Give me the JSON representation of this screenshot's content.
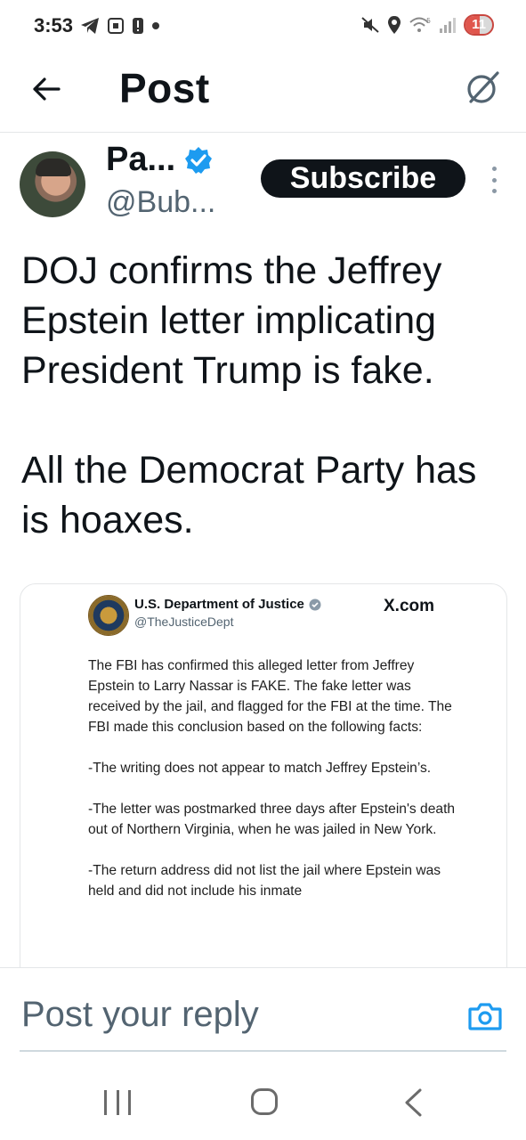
{
  "status_bar": {
    "time": "3:53",
    "battery": "11",
    "icons": [
      "telegram-icon",
      "screenshot-icon",
      "alert-icon",
      "dot-icon",
      "mute-icon",
      "location-icon",
      "wifi-icon",
      "signal-icon"
    ]
  },
  "header": {
    "title": "Post",
    "back_icon": "arrow-left-icon",
    "grok_icon": "grok-icon"
  },
  "author": {
    "display_name": "Pa...",
    "handle": "@Bub...",
    "subscribe_label": "Subscribe"
  },
  "post": {
    "paragraphs": [
      "DOJ confirms the Jeffrey Epstein letter implicating President Trump is fake.",
      "All the Democrat Party has is hoaxes."
    ]
  },
  "embed": {
    "name": "U.S. Department of Justice",
    "handle": "@TheJusticeDept",
    "source": "X.com",
    "paragraphs": [
      "The FBI has confirmed this alleged letter from Jeffrey Epstein to Larry Nassar is FAKE. The fake letter was received by the jail, and flagged for the FBI at the time. The FBI made this conclusion based on the following facts:",
      "-The writing does not appear to match Jeffrey Epstein’s.",
      "-The letter was postmarked three days after Epstein's death out of Northern Virginia, when he was jailed in New York.",
      "-The return address did not list the jail where Epstein was held and did not include his inmate"
    ]
  },
  "reply": {
    "placeholder": "Post your reply"
  },
  "colors": {
    "verified_blue": "#1d9bf0",
    "text_primary": "#0f1419",
    "text_secondary": "#536471",
    "battery_red": "#e0564d"
  }
}
